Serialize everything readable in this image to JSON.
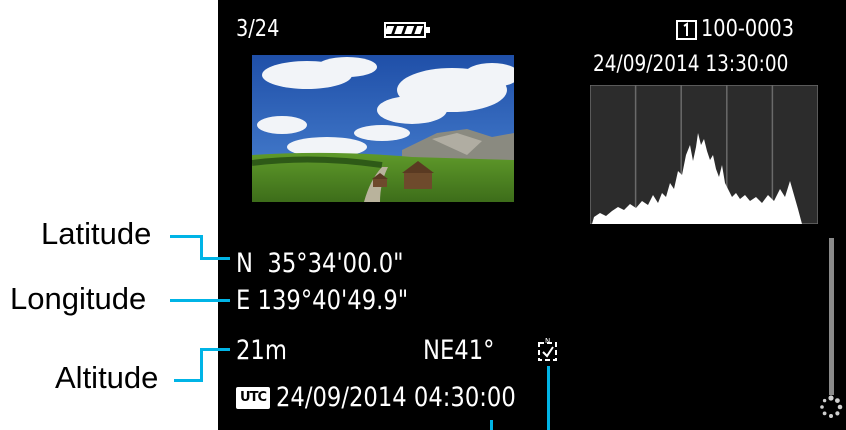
{
  "header": {
    "frame_counter": "3/24",
    "folder_file": "100-0003",
    "date_time": "24/09/2014 13:30:00"
  },
  "gps": {
    "latitude": "N  35°34'00.0\"",
    "longitude": "E 139°40'49.9\"",
    "altitude": "21m",
    "direction": "NE41°",
    "utc_badge": "UTC",
    "utc_time": "24/09/2014 04:30:00"
  },
  "callouts": {
    "latitude": "Latitude",
    "longitude": "Longitude",
    "altitude": "Altitude"
  },
  "icons": {
    "battery": "battery-full-icon",
    "card": "card-1-icon",
    "compass": "digital-compass-icon",
    "utc": "utc-badge-icon"
  },
  "colors": {
    "screen": "#000000",
    "leader": "#00b4e6",
    "histogram": "#ffffff"
  }
}
